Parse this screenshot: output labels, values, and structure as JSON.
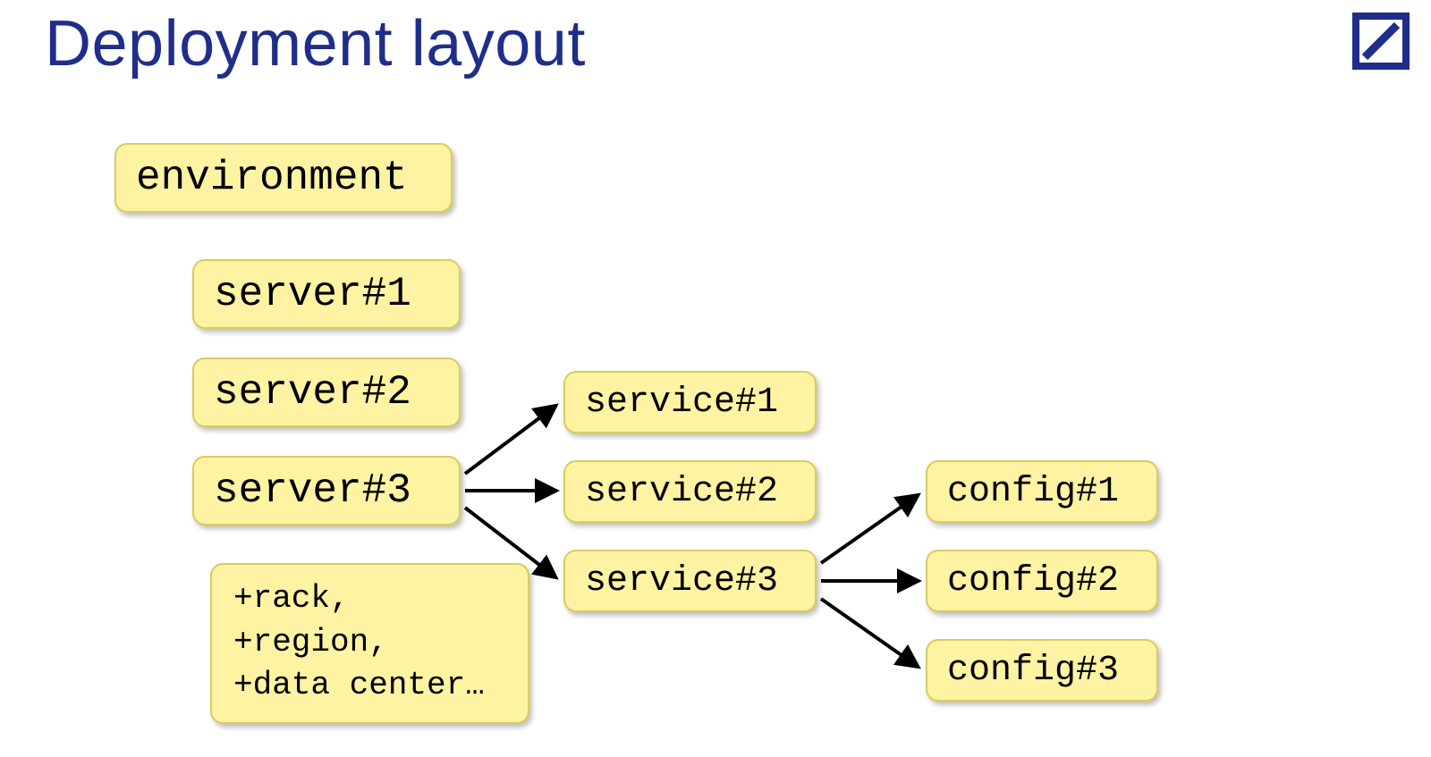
{
  "title": "Deployment layout",
  "nodes": {
    "environment": "environment",
    "server1": "server#1",
    "server2": "server#2",
    "server3": "server#3",
    "service1": "service#1",
    "service2": "service#2",
    "service3": "service#3",
    "config1": "config#1",
    "config2": "config#2",
    "config3": "config#3"
  },
  "note_lines": [
    "+rack,",
    "+region,",
    "+data center…"
  ],
  "colors": {
    "title": "#1f2e8a",
    "box_fill": "#fdf3a2",
    "box_border": "#d9cc5e",
    "logo": "#1f2e8a"
  },
  "edges": [
    {
      "from": "server3",
      "to": "service1"
    },
    {
      "from": "server3",
      "to": "service2"
    },
    {
      "from": "server3",
      "to": "service3"
    },
    {
      "from": "service3",
      "to": "config1"
    },
    {
      "from": "service3",
      "to": "config2"
    },
    {
      "from": "service3",
      "to": "config3"
    }
  ]
}
